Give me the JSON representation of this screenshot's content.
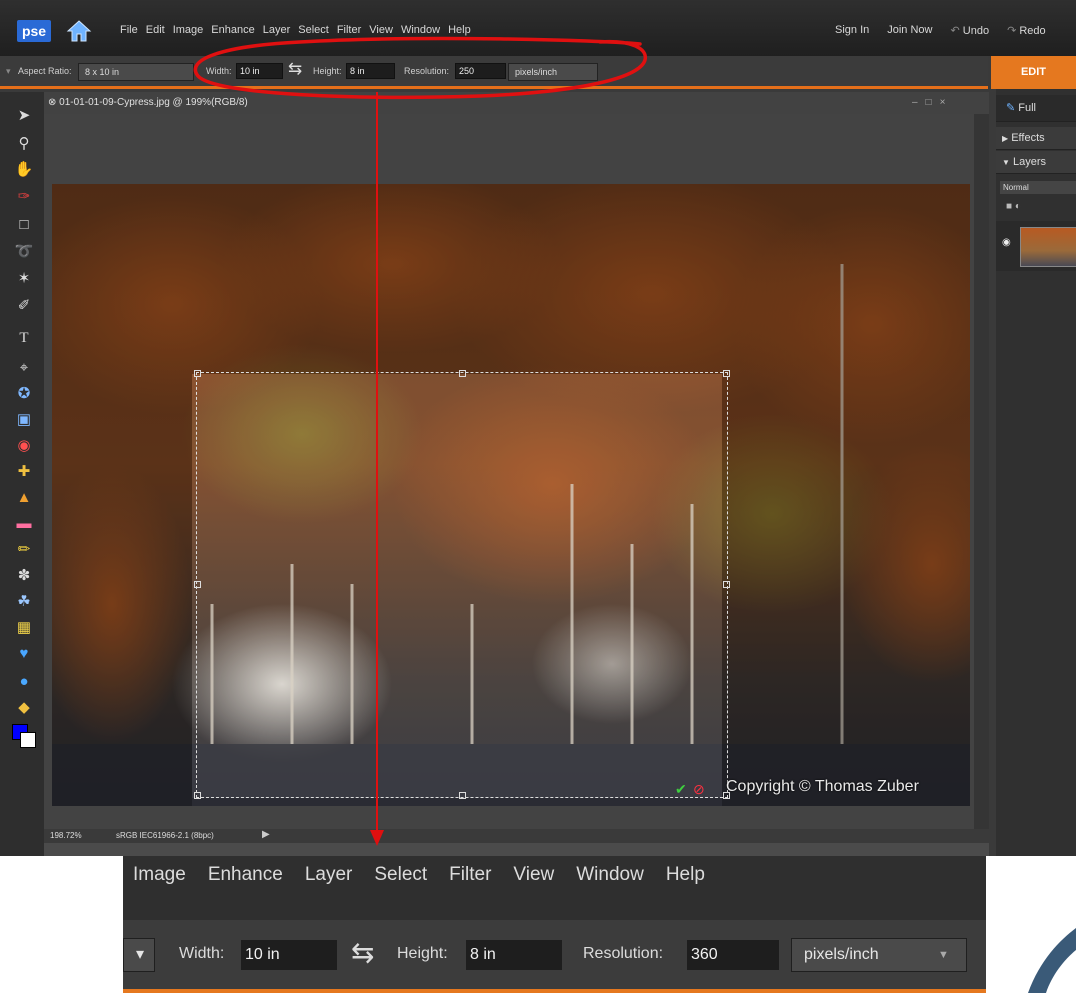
{
  "app": {
    "logo": "pse",
    "home_icon": "home-icon"
  },
  "menu": {
    "items": [
      "File",
      "Edit",
      "Image",
      "Enhance",
      "Layer",
      "Select",
      "Filter",
      "View",
      "Window",
      "Help"
    ]
  },
  "header_links": {
    "sign_in": "Sign In",
    "join_now": "Join Now",
    "undo": "Undo",
    "redo": "Redo"
  },
  "options": {
    "aspect_label": "Aspect Ratio:",
    "aspect_value": "8 x 10 in",
    "width_label": "Width:",
    "width_value": "10 in",
    "height_label": "Height:",
    "height_value": "8 in",
    "resolution_label": "Resolution:",
    "resolution_value": "250",
    "units": "pixels/inch"
  },
  "mode_tab": "EDIT",
  "document": {
    "title": "01-01-01-09-Cypress.jpg @ 199%(RGB/8)",
    "zoom": "198.72%",
    "profile": "sRGB IEC61966-2.1 (8bpc)",
    "watermark": "Copyright © Thomas Zuber"
  },
  "panel": {
    "full": "Full",
    "effects": "Effects",
    "layers": "Layers",
    "blend_mode": "Normal"
  },
  "zoom_inset": {
    "menu_items": [
      "Image",
      "Enhance",
      "Layer",
      "Select",
      "Filter",
      "View",
      "Window",
      "Help"
    ],
    "width_label": "Width:",
    "width_value": "10 in",
    "height_label": "Height:",
    "height_value": "8 in",
    "resolution_label": "Resolution:",
    "resolution_value": "360",
    "units": "pixels/inch"
  },
  "colors": {
    "accent": "#e5781f",
    "annotation": "#e01010",
    "foreground": "#0000ff",
    "background": "#ffffff"
  }
}
